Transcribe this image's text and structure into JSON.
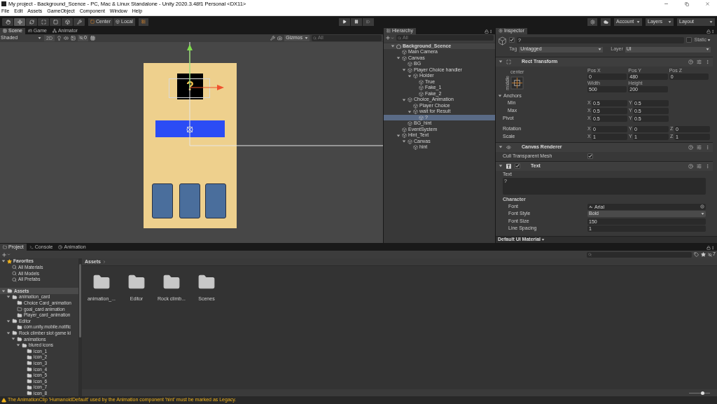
{
  "window": {
    "title": "My project - Background_Scence - PC, Mac & Linux Standalone - Unity 2020.3.48f1 Personal <DX11>"
  },
  "menu": [
    "File",
    "Edit",
    "Assets",
    "GameObject",
    "Component",
    "Window",
    "Help"
  ],
  "toolbar": {
    "tools": [
      {
        "kind": "hand",
        "selected": false
      },
      {
        "kind": "move",
        "selected": true
      },
      {
        "kind": "rotate",
        "selected": false
      },
      {
        "kind": "scale",
        "selected": false
      },
      {
        "kind": "rect",
        "selected": false
      },
      {
        "kind": "transform",
        "selected": false
      },
      {
        "kind": "custom",
        "selected": false
      }
    ],
    "pivot": "Center",
    "space": "Local",
    "account": "Account",
    "layers": "Layers",
    "layout": "Layout"
  },
  "scene_panel": {
    "tabs": [
      {
        "label": "Scene",
        "kind": "scene",
        "selected": true
      },
      {
        "label": "Game",
        "kind": "game",
        "selected": false
      },
      {
        "label": "Animator",
        "kind": "animator",
        "selected": false
      }
    ],
    "shading": "Shaded",
    "mode_2d": "2D",
    "hidden_count": "0",
    "gizmos": "Gizmos",
    "search_placeholder": "All",
    "card_text": "?"
  },
  "hierarchy": {
    "title": "Hierarchy",
    "search_placeholder": "All",
    "tree": [
      {
        "label": "Background_Scence",
        "kind": "scene",
        "expanded": true,
        "selected": false,
        "children": [
          {
            "label": "Main Camera",
            "kind": "object",
            "selected": false
          },
          {
            "label": "Canvas",
            "kind": "object",
            "expanded": true,
            "selected": false,
            "children": [
              {
                "label": "BG",
                "kind": "object",
                "selected": false
              },
              {
                "label": "Player Choice handler",
                "kind": "object",
                "expanded": true,
                "selected": false,
                "children": [
                  {
                    "label": "Holder",
                    "kind": "object",
                    "expanded": true,
                    "selected": false,
                    "children": [
                      {
                        "label": "True",
                        "kind": "object",
                        "selected": false
                      },
                      {
                        "label": "Fake_1",
                        "kind": "object",
                        "selected": false
                      },
                      {
                        "label": "Fake_2",
                        "kind": "object",
                        "selected": false
                      }
                    ]
                  }
                ]
              },
              {
                "label": "Choice_Animation",
                "kind": "object",
                "expanded": true,
                "selected": false,
                "children": [
                  {
                    "label": "Player Choice",
                    "kind": "object",
                    "selected": false
                  },
                  {
                    "label": "wait for Result",
                    "kind": "object",
                    "expanded": true,
                    "selected": false,
                    "children": [
                      {
                        "label": "?",
                        "kind": "object",
                        "selected": true
                      }
                    ]
                  }
                ]
              },
              {
                "label": "BG_hint",
                "kind": "object",
                "selected": false
              }
            ]
          },
          {
            "label": "EventSystem",
            "kind": "object",
            "selected": false
          },
          {
            "label": "Hint_Text",
            "kind": "object",
            "expanded": true,
            "selected": false,
            "children": [
              {
                "label": "Canvas",
                "kind": "object",
                "expanded": true,
                "selected": false,
                "children": [
                  {
                    "label": "hint",
                    "kind": "object",
                    "selected": false
                  }
                ]
              }
            ]
          }
        ]
      }
    ]
  },
  "inspector": {
    "title": "Inspector",
    "active": true,
    "name": "?",
    "static_label": "Static",
    "static": false,
    "tag_label": "Tag",
    "tag": "Untagged",
    "layer_label": "Layer",
    "layer": "UI",
    "rect_transform": {
      "title": "Rect Transform",
      "expanded": true,
      "anchor_h": "center",
      "anchor_v": "middle",
      "fields": [
        {
          "label": "Pos X",
          "value": "0"
        },
        {
          "label": "Pos Y",
          "value": "480"
        },
        {
          "label": "Pos Z",
          "value": "0"
        },
        {
          "label": "Width",
          "value": "500"
        },
        {
          "label": "Height",
          "value": "200"
        }
      ],
      "anchors": {
        "label": "Anchors",
        "expanded": true,
        "rows": [
          {
            "label": "Min",
            "axes": [
              {
                "axis": "X",
                "value": "0.5"
              },
              {
                "axis": "Y",
                "value": "0.5"
              }
            ]
          },
          {
            "label": "Max",
            "axes": [
              {
                "axis": "X",
                "value": "0.5"
              },
              {
                "axis": "Y",
                "value": "0.5"
              }
            ]
          }
        ]
      },
      "rows": [
        {
          "label": "Pivot",
          "axes": [
            {
              "axis": "X",
              "value": "0.5"
            },
            {
              "axis": "Y",
              "value": "0.5"
            }
          ]
        },
        {
          "label": "Rotation",
          "axes": [
            {
              "axis": "X",
              "value": "0"
            },
            {
              "axis": "Y",
              "value": "0"
            },
            {
              "axis": "Z",
              "value": "0"
            }
          ]
        },
        {
          "label": "Scale",
          "axes": [
            {
              "axis": "X",
              "value": "1"
            },
            {
              "axis": "Y",
              "value": "1"
            },
            {
              "axis": "Z",
              "value": "1"
            }
          ]
        }
      ]
    },
    "canvas_renderer": {
      "title": "Canvas Renderer",
      "expanded": true,
      "cull_label": "Cull Transparent Mesh",
      "cull": true
    },
    "text": {
      "title": "Text",
      "expanded": true,
      "enabled": true,
      "text_label": "Text",
      "value": "?",
      "character_label": "Character",
      "props": [
        {
          "label": "Font",
          "value": "Arial",
          "kind": "object"
        },
        {
          "label": "Font Style",
          "value": "Bold",
          "kind": "dropdown"
        },
        {
          "label": "Font Size",
          "value": "150",
          "kind": "field"
        },
        {
          "label": "Line Spacing",
          "value": "1",
          "kind": "field"
        }
      ]
    },
    "material": "Default UI Material"
  },
  "project_panel": {
    "tabs": [
      {
        "label": "Project",
        "kind": "project",
        "selected": true
      },
      {
        "label": "Console",
        "kind": "console",
        "selected": false
      },
      {
        "label": "Animation",
        "kind": "animation",
        "selected": false
      }
    ],
    "breadcrumb": "Assets",
    "hidden_count": "7",
    "tree": [
      {
        "label": "Favorites",
        "kind": "favorites",
        "expanded": true,
        "selected": false,
        "children": [
          {
            "label": "All Materials",
            "kind": "search",
            "selected": false
          },
          {
            "label": "All Models",
            "kind": "search",
            "selected": false
          },
          {
            "label": "All Prefabs",
            "kind": "search",
            "selected": false
          }
        ]
      },
      {
        "label": "Assets",
        "kind": "folder",
        "expanded": true,
        "selected": true,
        "children": [
          {
            "label": "animation_card",
            "kind": "folder",
            "expanded": true,
            "selected": false,
            "children": [
              {
                "label": "Choice Card_animation",
                "kind": "folder",
                "selected": false
              },
              {
                "label": "goal_card animation",
                "kind": "empty_folder",
                "selected": false
              },
              {
                "label": "Player_card_animation",
                "kind": "folder",
                "selected": false
              }
            ]
          },
          {
            "label": "Editor",
            "kind": "folder",
            "expanded": true,
            "selected": false,
            "children": [
              {
                "label": "com.unity.mobile.notific",
                "kind": "folder",
                "selected": false
              }
            ]
          },
          {
            "label": "Rock climber slot game ki",
            "kind": "folder",
            "expanded": true,
            "selected": false,
            "children": [
              {
                "label": "animations",
                "kind": "folder",
                "expanded": true,
                "selected": false,
                "children": [
                  {
                    "label": "blured icons",
                    "kind": "folder",
                    "expanded": true,
                    "selected": false,
                    "children": [
                      {
                        "label": "icon_1",
                        "kind": "folder",
                        "selected": false
                      },
                      {
                        "label": "icon_2",
                        "kind": "folder",
                        "selected": false
                      },
                      {
                        "label": "icon_3",
                        "kind": "folder",
                        "selected": false
                      },
                      {
                        "label": "icon_4",
                        "kind": "folder",
                        "selected": false
                      },
                      {
                        "label": "icon_5",
                        "kind": "folder",
                        "selected": false
                      },
                      {
                        "label": "icon_6",
                        "kind": "folder",
                        "selected": false
                      },
                      {
                        "label": "icon_7",
                        "kind": "folder",
                        "selected": false
                      },
                      {
                        "label": "icon_8",
                        "kind": "folder",
                        "selected": false
                      }
                    ]
                  }
                ]
              }
            ]
          }
        ]
      }
    ],
    "items": [
      {
        "label": "animation_..."
      },
      {
        "label": "Editor"
      },
      {
        "label": "Rock climb..."
      },
      {
        "label": "Scenes"
      }
    ],
    "icon_size": {
      "level": 0.65
    }
  },
  "status_bar": {
    "message": "The AnimationClip 'HumanoidDefault' used by the Animation component 'hint' must be marked as Legacy."
  }
}
